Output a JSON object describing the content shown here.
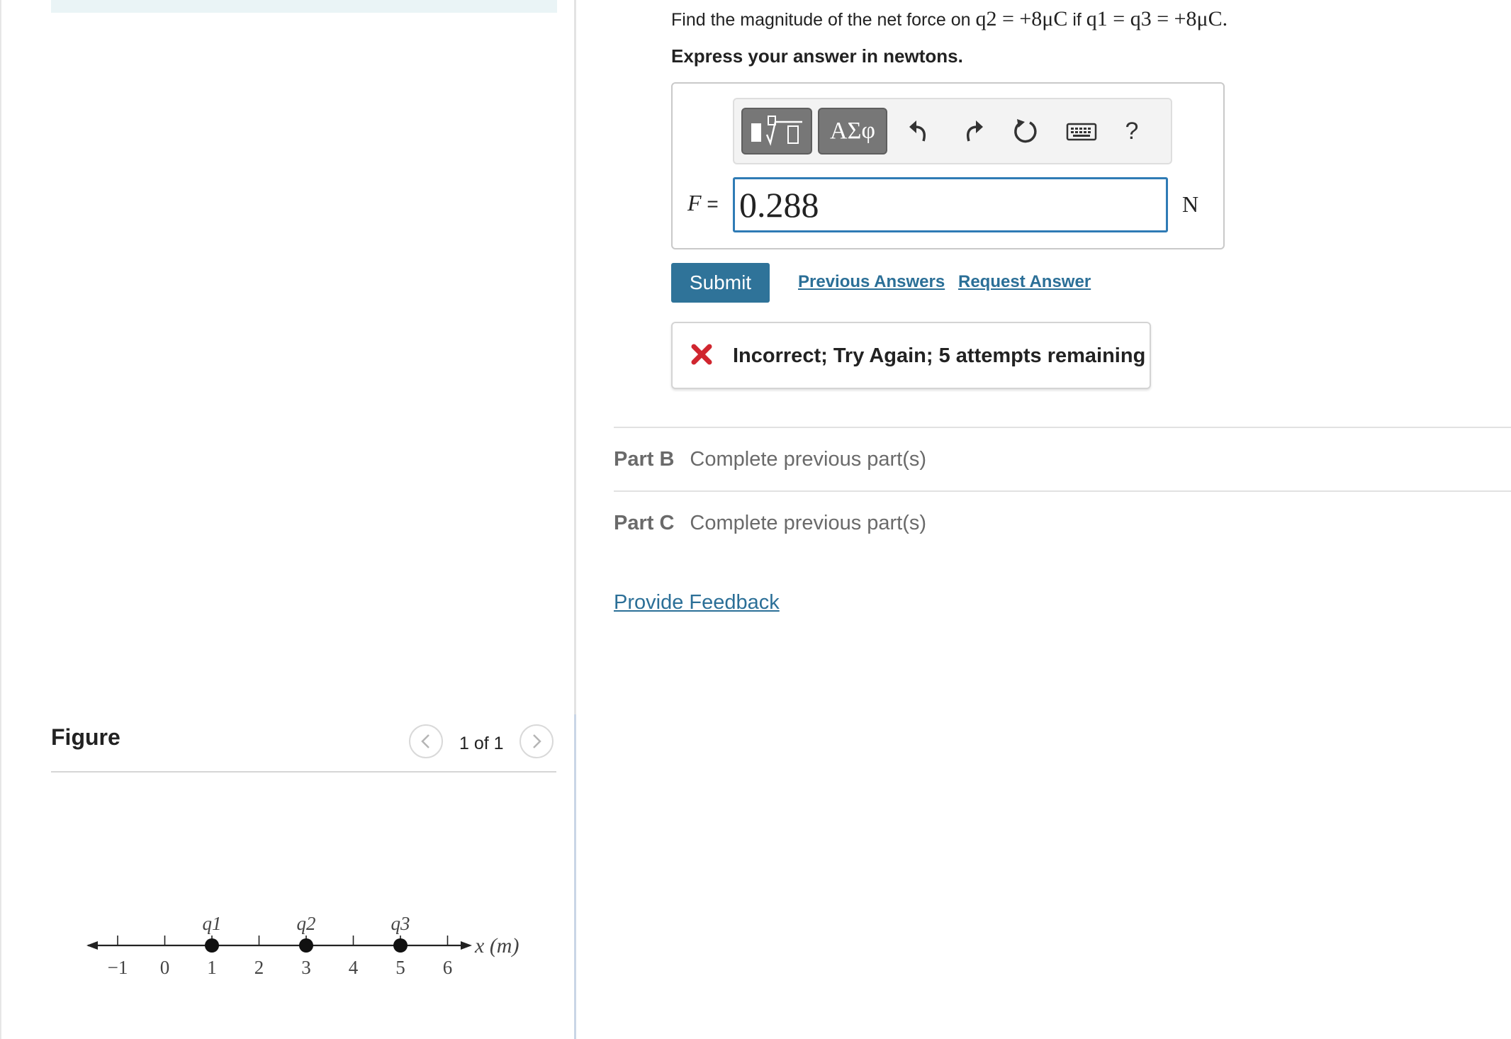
{
  "question": {
    "prefix": "Find the magnitude of the net force on ",
    "target_charge": "q2 = +8μC",
    "connector": " if ",
    "given": "q1 = q3 = +8μC.",
    "instruction": "Express your answer in newtons."
  },
  "toolbar": {
    "templates_icon": "templates-sqrt-icon",
    "symbols_label": "ΑΣφ",
    "undo_icon": "undo-icon",
    "redo_icon": "redo-icon",
    "reset_icon": "reset-icon",
    "keyboard_icon": "keyboard-icon",
    "help_label": "?"
  },
  "answer": {
    "variable_label": "F",
    "equals": "=",
    "value": "0.288",
    "unit": "N"
  },
  "actions": {
    "submit_label": "Submit",
    "previous_answers_label": "Previous Answers",
    "request_answer_label": "Request Answer"
  },
  "feedback": {
    "icon": "incorrect-x-icon",
    "message": "Incorrect; Try Again; 5 attempts remaining",
    "color": "#d0262f"
  },
  "parts": [
    {
      "label": "Part B",
      "status": "Complete previous part(s)"
    },
    {
      "label": "Part C",
      "status": "Complete previous part(s)"
    }
  ],
  "provide_feedback_label": "Provide Feedback",
  "figure": {
    "title": "Figure",
    "pager": "1 of 1",
    "prev_icon": "chevron-left-icon",
    "next_icon": "chevron-right-icon",
    "axis_label": "x (m)",
    "ticks": [
      "−1",
      "0",
      "1",
      "2",
      "3",
      "4",
      "5",
      "6"
    ],
    "charges": [
      {
        "label": "q1",
        "x": 1
      },
      {
        "label": "q2",
        "x": 3
      },
      {
        "label": "q3",
        "x": 5
      }
    ]
  },
  "colors": {
    "accent": "#2f7399",
    "link": "#2b6f97",
    "input_border": "#2f7bb5"
  }
}
